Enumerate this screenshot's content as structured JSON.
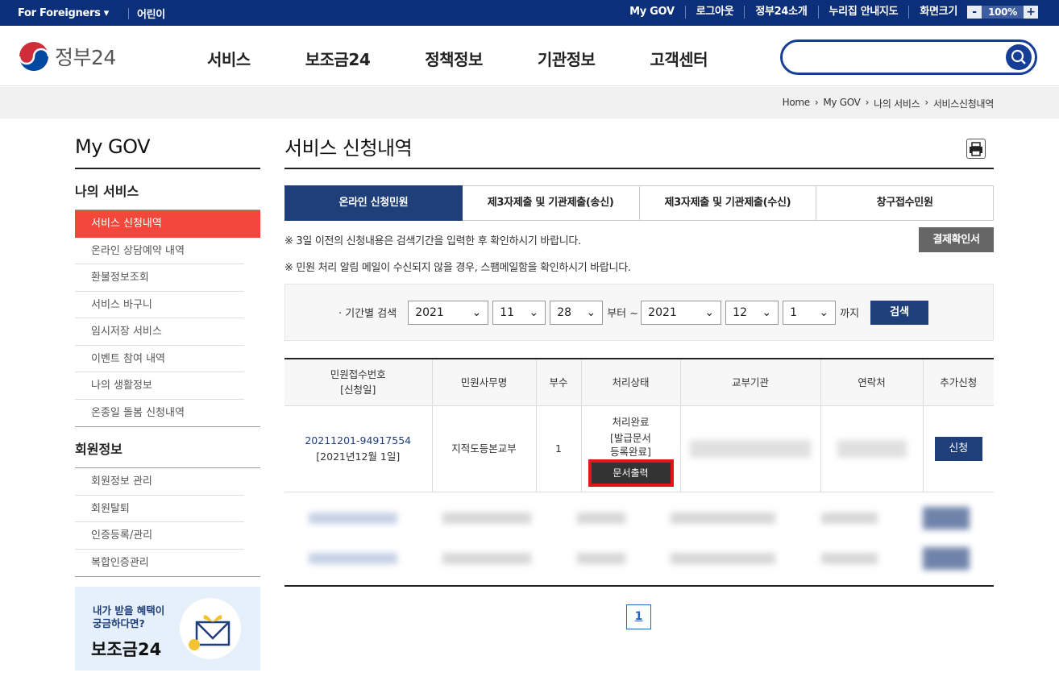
{
  "topbar": {
    "foreigners": "For Foreigners",
    "kids": "어린이",
    "mygov": "My GOV",
    "logout": "로그아웃",
    "intro": "정부24소개",
    "map": "누리집 안내지도",
    "screen": "화면크기",
    "minus": "-",
    "zoom": "100%",
    "plus": "+"
  },
  "header": {
    "logo": "정부24",
    "menu": [
      "서비스",
      "보조금24",
      "정책정보",
      "기관정보",
      "고객센터"
    ]
  },
  "breadcrumb": [
    "Home",
    "My GOV",
    "나의 서비스",
    "서비스신청내역"
  ],
  "lnb": {
    "title": "My GOV",
    "group1": "나의 서비스",
    "items1": [
      "서비스 신청내역",
      "온라인 상담예약 내역",
      "환불정보조회",
      "서비스 바구니",
      "임시저장 서비스",
      "이벤트 참여 내역",
      "나의 생활정보",
      "온종일 돌봄 신청내역"
    ],
    "group2": "회원정보",
    "items2": [
      "회원정보 관리",
      "회원탈퇴",
      "인증등록/관리",
      "복합인증관리"
    ],
    "banner_line1": "내가 받을 혜택이",
    "banner_line2": "궁금하다면?",
    "banner_big": "보조금24"
  },
  "main": {
    "title": "서비스 신청내역",
    "tabs": [
      "온라인 신청민원",
      "제3자제출 및 기관제출(송신)",
      "제3자제출 및 기관제출(수신)",
      "창구접수민원"
    ],
    "notice1": "※ 3일 이전의 신청내용은 검색기간을 입력한 후 확인하시기 바랍니다.",
    "notice2": "※ 민원 처리 알림 메일이 수신되지 않을 경우, 스팸메일함을 확인하시기 바랍니다.",
    "receipt_btn": "결제확인서",
    "filter": {
      "label": "· 기간별 검색",
      "from_year": "2021",
      "from_month": "11",
      "from_day": "28",
      "mid": "부터 ~",
      "to_year": "2021",
      "to_month": "12",
      "to_day": "1",
      "end": "까지",
      "search": "검색"
    },
    "table": {
      "headers": [
        "민원접수번호\n[신청일]",
        "민원사무명",
        "부수",
        "처리상태",
        "교부기관",
        "연락처",
        "추가신청"
      ],
      "row1": {
        "no": "20211201-94917554",
        "date": "[2021년12월 1일]",
        "name": "지적도등본교부",
        "count": "1",
        "status1": "처리완료",
        "status2": "[발급문서",
        "status3": "등록완료]",
        "print": "문서출력",
        "apply": "신청"
      }
    },
    "page": "1"
  }
}
